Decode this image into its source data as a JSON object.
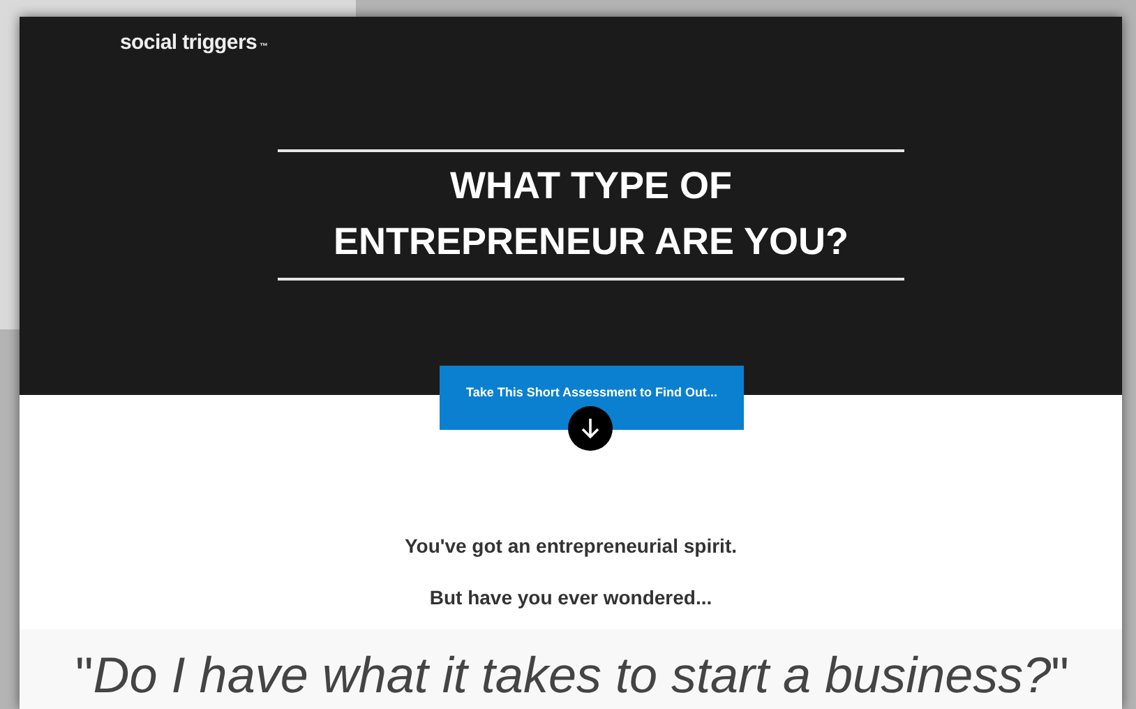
{
  "logo": {
    "text": "social triggers",
    "mark": "™"
  },
  "hero": {
    "title_lines": [
      "WHAT TYPE OF",
      "ENTREPRENEUR ARE YOU?"
    ]
  },
  "cta": {
    "label": "Take This Short Assessment to Find Out..."
  },
  "intro": [
    "You've got an entrepreneurial spirit.",
    "But have you ever wondered..."
  ],
  "quote": "\"*Do I have what it takes to start a business?*\""
}
